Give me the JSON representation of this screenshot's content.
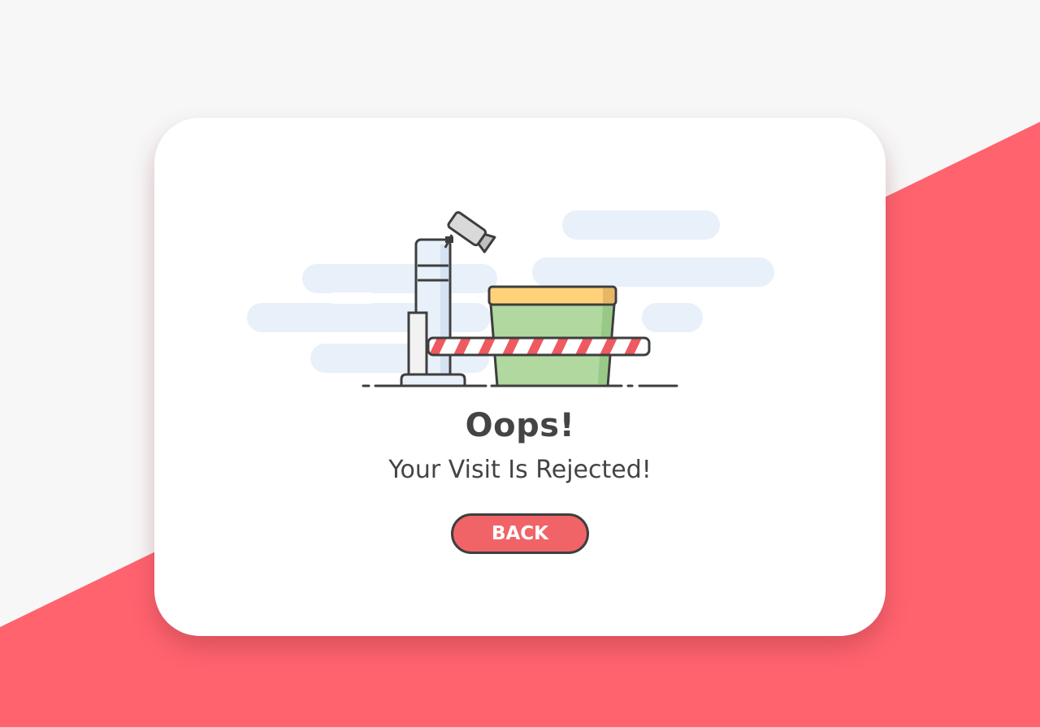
{
  "message": {
    "title": "Oops!",
    "subtitle": "Your Visit Is Rejected!"
  },
  "actions": {
    "back_label": "BACK"
  },
  "colors": {
    "background": "#f7f7f7",
    "accent_stripe": "#ff636e",
    "card": "#ffffff",
    "button": "#f06468",
    "text": "#444444",
    "cloud": "#e8f0fa",
    "crate_body": "#b0d89f",
    "crate_lid": "#ffd27a",
    "barrier_stripe": "#ee5a60"
  },
  "illustration": {
    "icon": "road-barrier-illustration",
    "parts": [
      "camera-icon",
      "barrier-post",
      "barrier-arm",
      "crate",
      "clouds"
    ]
  }
}
